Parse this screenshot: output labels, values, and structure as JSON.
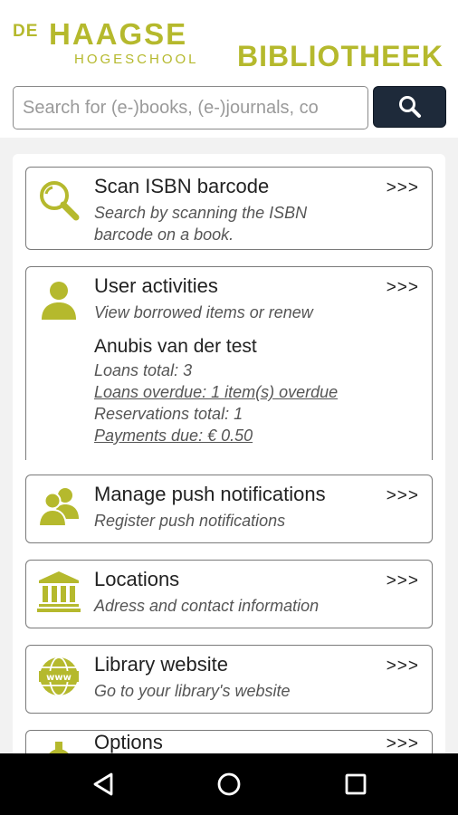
{
  "header": {
    "logo_de": "DE",
    "logo_haagse": "HAAGSE",
    "logo_hogeschool": "HOGESCHOOL",
    "logo_bibliotheek": "BIBLIOTHEEK"
  },
  "search": {
    "placeholder": "Search for (e-)books, (e-)journals, co",
    "value": ""
  },
  "cards": [
    {
      "title": "Scan ISBN barcode",
      "desc": "Search by scanning the ISBN barcode on a book.",
      "arrow": ">>>",
      "icon": "magnifier-icon"
    },
    {
      "title": "User activities",
      "desc": "View borrowed items or renew",
      "arrow": ">>>",
      "icon": "user-icon"
    },
    {
      "title": "Manage push notifications",
      "desc": "Register push notifications",
      "arrow": ">>>",
      "icon": "users-icon"
    },
    {
      "title": "Locations",
      "desc": "Adress and contact information",
      "arrow": ">>>",
      "icon": "building-icon"
    },
    {
      "title": "Library website",
      "desc": "Go to your library's website",
      "arrow": ">>>",
      "icon": "www-globe-icon"
    },
    {
      "title": "Options",
      "arrow": ">>>",
      "icon": "gear-icon"
    }
  ],
  "user": {
    "name": "Anubis van der test",
    "loans_total": "Loans total: 3",
    "loans_overdue": "Loans overdue: 1 item(s) overdue",
    "reservations_total": "Reservations total: 1",
    "payments_due": "Payments due: € 0.50"
  },
  "colors": {
    "brand": "#b5b92d",
    "search_button": "#1e2a3a",
    "navbar": "#000000"
  },
  "navbar": {
    "icons": [
      "back-icon",
      "home-icon",
      "recents-icon"
    ]
  }
}
